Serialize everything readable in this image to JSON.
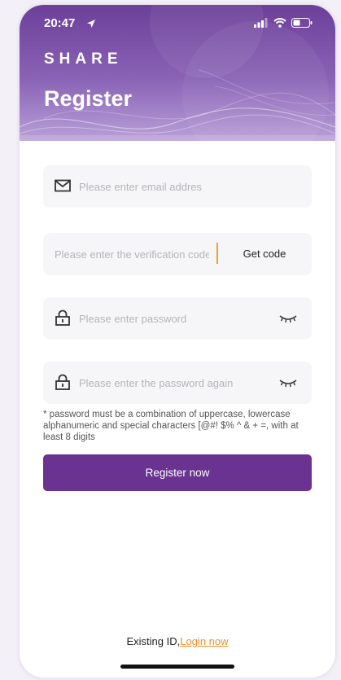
{
  "status_bar": {
    "time": "20:47"
  },
  "brand": "SHARE",
  "title": "Register",
  "email": {
    "placeholder": "Please enter email addres",
    "icon": "mail-icon"
  },
  "verification": {
    "placeholder": "Please enter the verification code",
    "button_label": "Get code"
  },
  "password": {
    "placeholder": "Please enter password",
    "icon": "lock-icon",
    "toggle_icon": "eye-closed-icon"
  },
  "password_again": {
    "placeholder": "Please enter the password again",
    "icon": "lock-icon",
    "toggle_icon": "eye-closed-icon"
  },
  "hint": "* password must be a combination of uppercase, lowercase alphanumeric and special characters [@#! $% ^ & + =, with at least 8 digits",
  "register_button": "Register now",
  "footer": {
    "prefix": "Existing ID,",
    "link": "Login now"
  },
  "colors": {
    "primary": "#6a3392",
    "accent": "#f0902a",
    "field_bg": "#f6f6f8"
  }
}
